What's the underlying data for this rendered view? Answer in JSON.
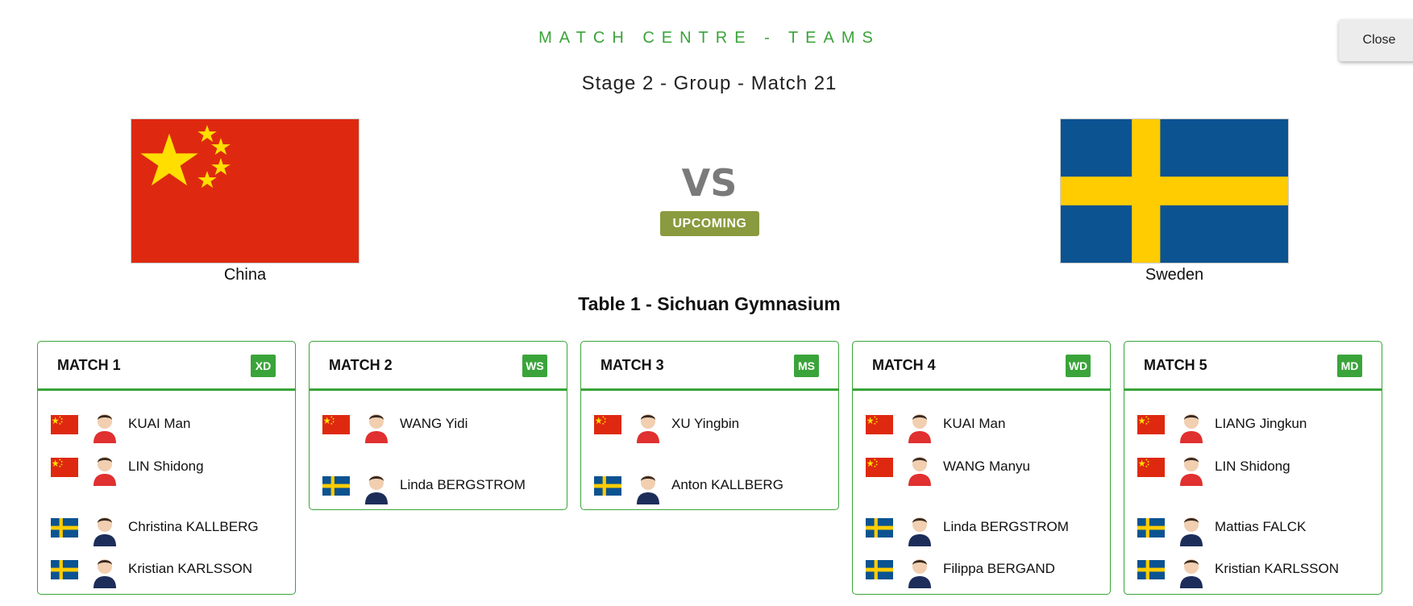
{
  "header": {
    "title": "MATCH CENTRE - TEAMS",
    "subtitle": "Stage 2 - Group - Match 21",
    "close_label": "Close"
  },
  "teams": {
    "home": {
      "name": "China",
      "flag": "china-flag"
    },
    "away": {
      "name": "Sweden",
      "flag": "sweden-flag"
    }
  },
  "vs_label": "VS",
  "status": "UPCOMING",
  "venue": "Table 1 - Sichuan Gymnasium",
  "colors": {
    "accent": "#3aa43a",
    "status": "#8a9a3e",
    "china_red": "#de2910",
    "china_yellow": "#ffde00",
    "sweden_blue": "#0b5391",
    "sweden_yellow": "#fecc00"
  },
  "matches": [
    {
      "title": "MATCH 1",
      "type": "XD",
      "home_players": [
        {
          "name": "KUAI Man",
          "flag": "china-flag"
        },
        {
          "name": "LIN Shidong",
          "flag": "china-flag"
        }
      ],
      "away_players": [
        {
          "name": "Christina KALLBERG",
          "flag": "sweden-flag"
        },
        {
          "name": "Kristian KARLSSON",
          "flag": "sweden-flag"
        }
      ]
    },
    {
      "title": "MATCH 2",
      "type": "WS",
      "home_players": [
        {
          "name": "WANG Yidi",
          "flag": "china-flag"
        }
      ],
      "away_players": [
        {
          "name": "Linda BERGSTROM",
          "flag": "sweden-flag"
        }
      ]
    },
    {
      "title": "MATCH 3",
      "type": "MS",
      "home_players": [
        {
          "name": "XU Yingbin",
          "flag": "china-flag"
        }
      ],
      "away_players": [
        {
          "name": "Anton KALLBERG",
          "flag": "sweden-flag"
        }
      ]
    },
    {
      "title": "MATCH 4",
      "type": "WD",
      "home_players": [
        {
          "name": "KUAI Man",
          "flag": "china-flag"
        },
        {
          "name": "WANG Manyu",
          "flag": "china-flag"
        }
      ],
      "away_players": [
        {
          "name": "Linda BERGSTROM",
          "flag": "sweden-flag"
        },
        {
          "name": "Filippa BERGAND",
          "flag": "sweden-flag"
        }
      ]
    },
    {
      "title": "MATCH 5",
      "type": "MD",
      "home_players": [
        {
          "name": "LIANG Jingkun",
          "flag": "china-flag"
        },
        {
          "name": "LIN Shidong",
          "flag": "china-flag"
        }
      ],
      "away_players": [
        {
          "name": "Mattias FALCK",
          "flag": "sweden-flag"
        },
        {
          "name": "Kristian KARLSSON",
          "flag": "sweden-flag"
        }
      ]
    }
  ]
}
